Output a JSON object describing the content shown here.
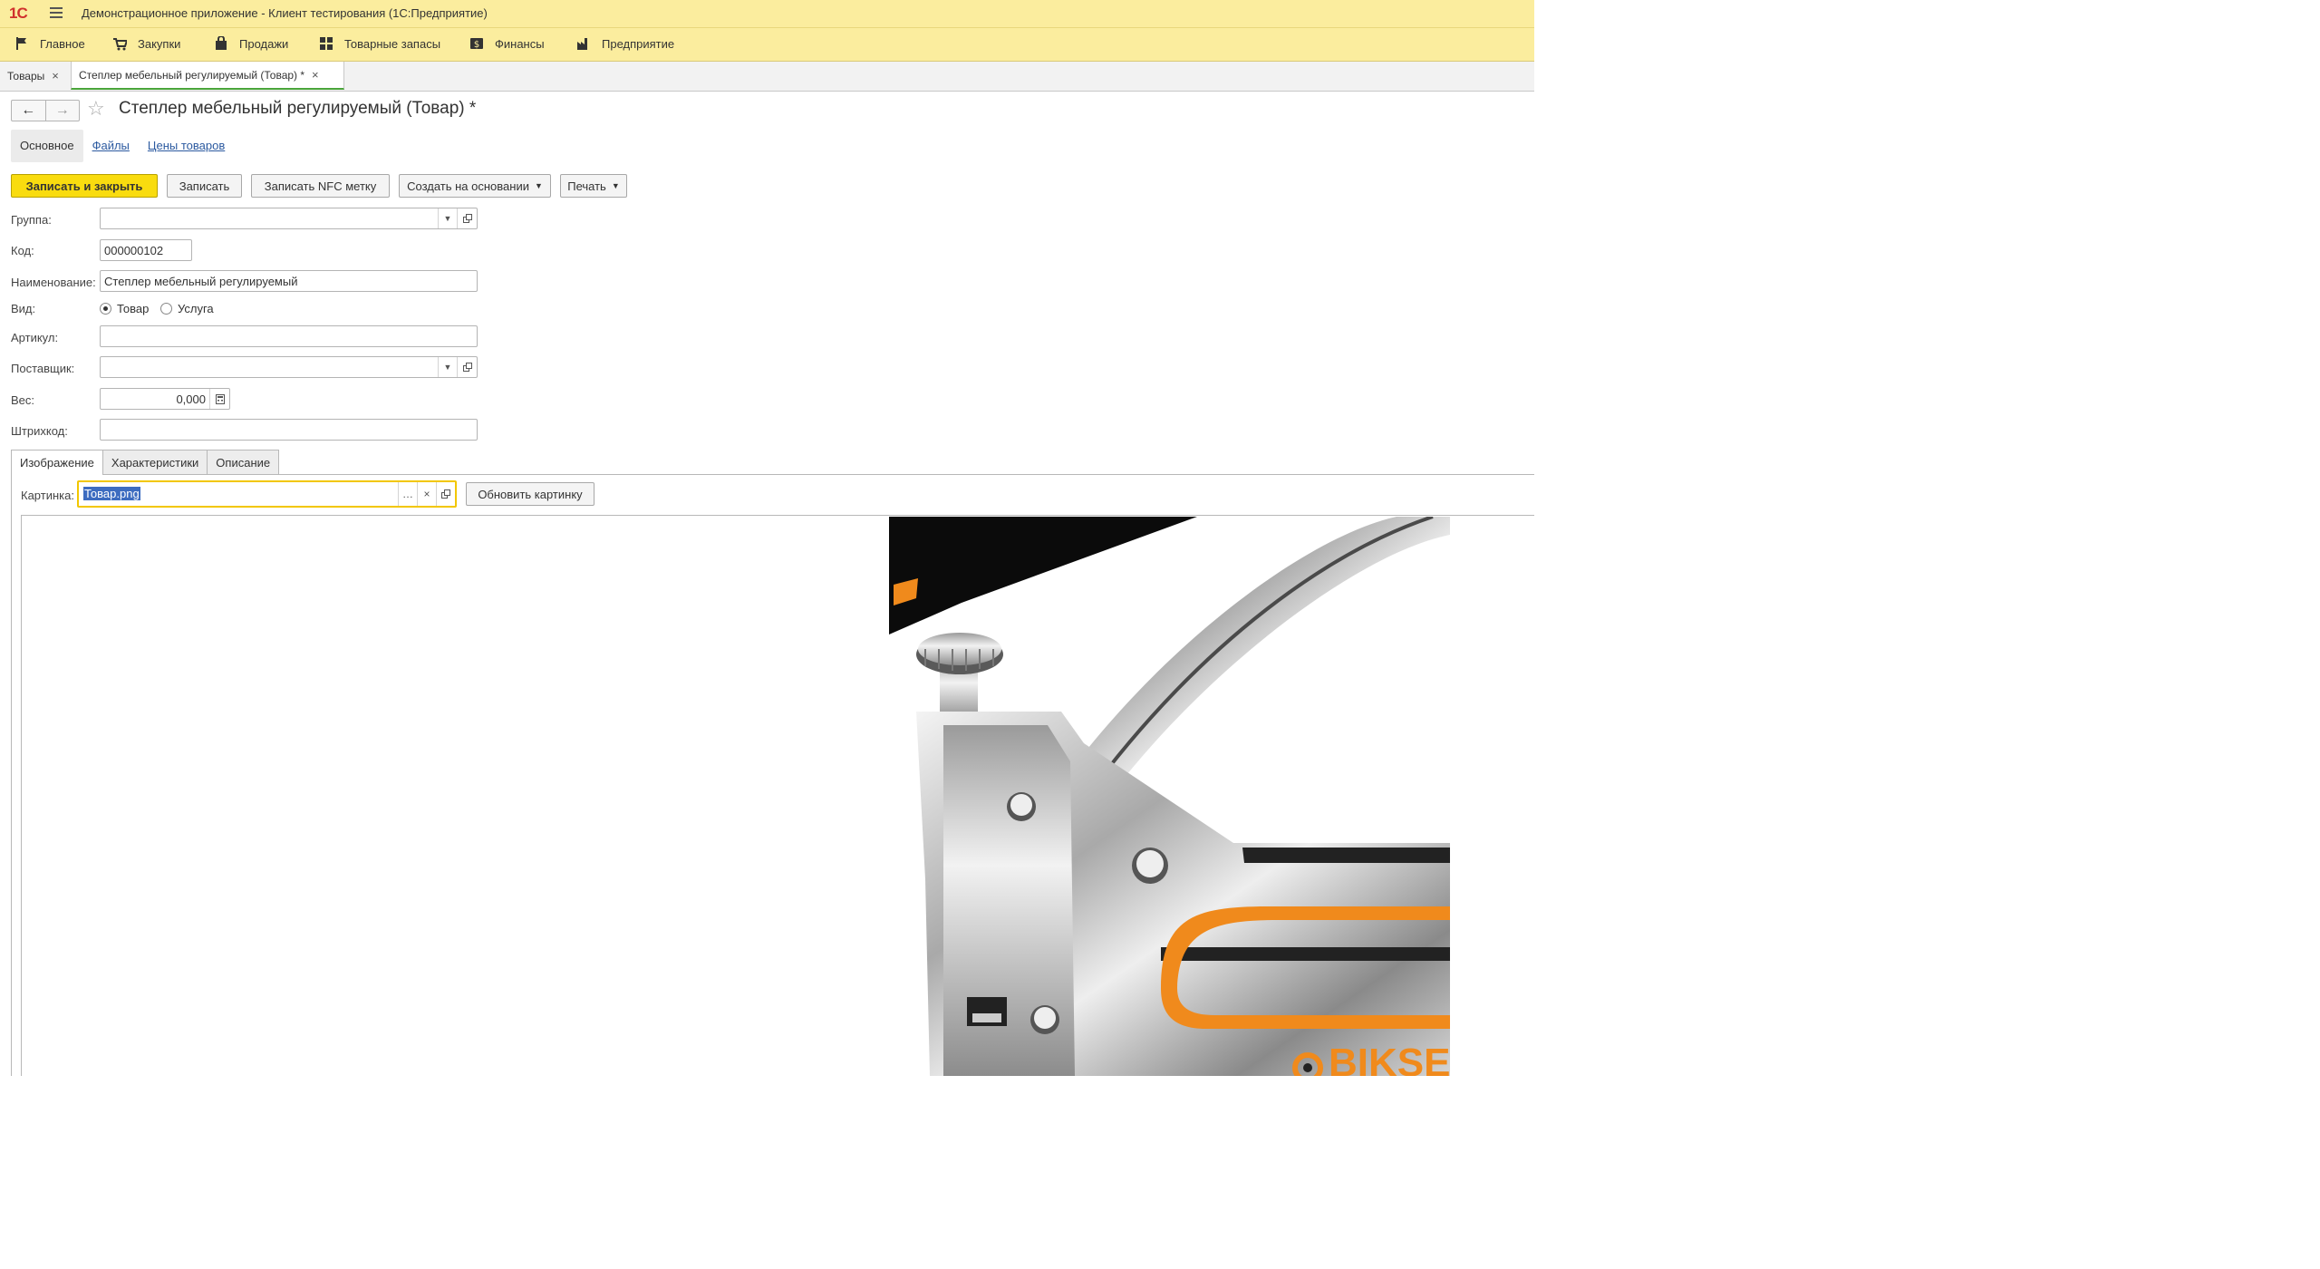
{
  "window": {
    "logo": "1С",
    "title": "Демонстрационное приложение  - Клиент тестирования (1С:Предприятие)"
  },
  "menu": [
    {
      "label": "Главное",
      "icon": "flag-icon"
    },
    {
      "label": "Закупки",
      "icon": "cart-icon"
    },
    {
      "label": "Продажи",
      "icon": "bag-icon"
    },
    {
      "label": "Товарные запасы",
      "icon": "grid-icon"
    },
    {
      "label": "Финансы",
      "icon": "money-icon"
    },
    {
      "label": "Предприятие",
      "icon": "factory-icon"
    }
  ],
  "open_tabs": [
    {
      "label": "Товары",
      "close": "×"
    },
    {
      "label": "Степлер мебельный регулируемый (Товар) *",
      "close": "×"
    }
  ],
  "form": {
    "title": "Степлер мебельный регулируемый (Товар) *",
    "subtabs": [
      "Основное",
      "Файлы",
      "Цены товаров"
    ],
    "toolbar": {
      "save_close": "Записать и закрыть",
      "save": "Записать",
      "write_nfc": "Записать NFC метку",
      "create_based": "Создать на основании",
      "print": "Печать"
    },
    "fields": {
      "group_label": "Группа:",
      "group_value": "",
      "code_label": "Код:",
      "code_value": "000000102",
      "name_label": "Наименование:",
      "name_value": "Степлер мебельный регулируемый",
      "kind_label": "Вид:",
      "kind_options": [
        "Товар",
        "Услуга"
      ],
      "kind_selected": "Товар",
      "article_label": "Артикул:",
      "article_value": "",
      "supplier_label": "Поставщик:",
      "supplier_value": "",
      "weight_label": "Вес:",
      "weight_value": "0,000",
      "barcode_label": "Штрихкод:",
      "barcode_value": ""
    },
    "page_tabs": [
      "Изображение",
      "Характеристики",
      "Описание"
    ],
    "picture": {
      "label": "Картинка:",
      "value": "Товар.png",
      "refresh": "Обновить картинку",
      "brand_text": "BIKSE"
    }
  },
  "colors": {
    "titlebar": "#fbed9e",
    "primary_button": "#f9dc0f",
    "link": "#2c5aa0",
    "active_tab_underline": "#4aa53a",
    "focus_border": "#f2c700",
    "brand_orange": "#f08a1c"
  }
}
